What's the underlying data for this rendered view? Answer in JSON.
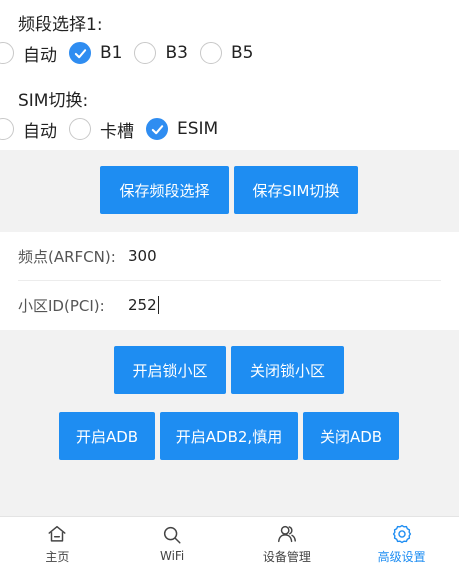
{
  "band_section": {
    "title": "频段选择1:",
    "options": [
      "自动",
      "B1",
      "B3",
      "B5"
    ],
    "selected": "B1"
  },
  "sim_section": {
    "title": "SIM切换:",
    "options": [
      "自动",
      "卡槽",
      "ESIM"
    ],
    "selected": "ESIM"
  },
  "save_buttons": {
    "save_band": "保存频段选择",
    "save_sim": "保存SIM切换"
  },
  "cell_info": {
    "arfcn_label": "频点(ARFCN):",
    "arfcn_value": "300",
    "pci_label": "小区ID(PCI):",
    "pci_value": "252"
  },
  "cell_lock_buttons": {
    "lock_on": "开启锁小区",
    "lock_off": "关闭锁小区"
  },
  "adb_buttons": {
    "adb_on": "开启ADB",
    "adb2_on": "开启ADB2,慎用",
    "adb_off": "关闭ADB"
  },
  "tabbar": {
    "items": [
      {
        "label": "主页",
        "icon": "home-icon"
      },
      {
        "label": "WiFi",
        "icon": "search-icon"
      },
      {
        "label": "设备管理",
        "icon": "users-icon"
      },
      {
        "label": "高级设置",
        "icon": "gear-icon"
      }
    ],
    "active": "高级设置"
  },
  "colors": {
    "accent": "#1e8df2",
    "band_background": "#f2f2f2"
  }
}
